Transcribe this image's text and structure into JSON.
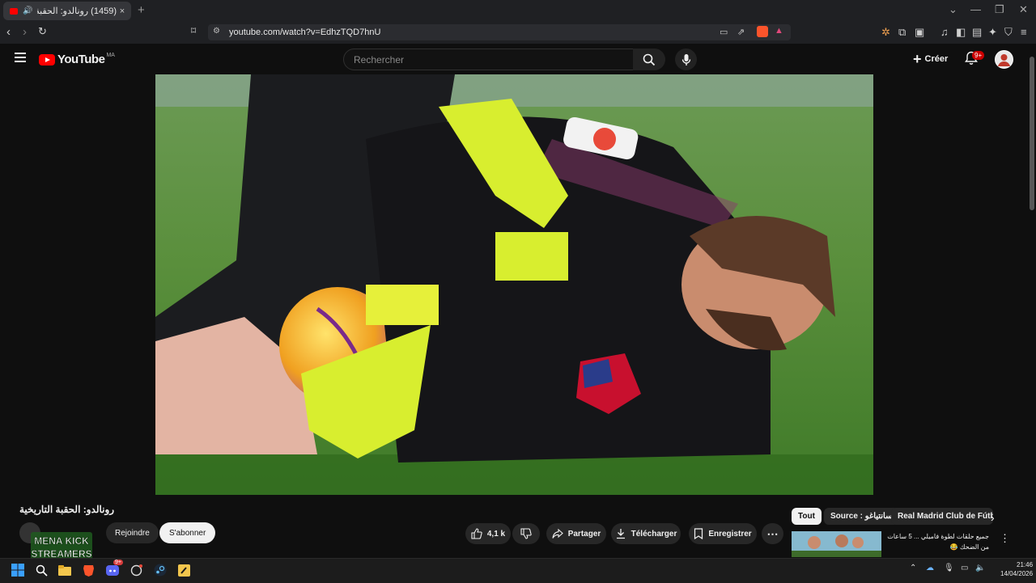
{
  "browser": {
    "tab_title": "(1459) رونالدو: الحقبة التاريخية",
    "url": "youtube.com/watch?v=EdhzTQD7hnU",
    "new_tab": "+",
    "tab_close": "×"
  },
  "youtube": {
    "logo_text": "YouTube",
    "country_code": "MA",
    "search_placeholder": "Rechercher",
    "create_label": "Créer",
    "notifications_badge": "9+"
  },
  "video": {
    "title": "رونالدو: الحقبة التاريخية",
    "join_label": "Rejoindre",
    "subscribe_label": "S'abonner",
    "like_count": "4,1 k",
    "share_label": "Partager",
    "download_label": "Télécharger",
    "save_label": "Enregistrer",
    "more": "⋯"
  },
  "watermark": {
    "line1": "MENA KICK",
    "line2": "STREAMERS"
  },
  "sidebar": {
    "chips": [
      "Tout",
      "Source : سانتياغو",
      "Real Madrid Club de Fútbol"
    ],
    "rec_title": "جميع حلقات لطوة فاميلي ... 5 ساعات من الضحك 😂"
  },
  "taskbar": {
    "time": "21:46",
    "date": "14/04/2026",
    "discord_badge": "9+"
  },
  "colors": {
    "accent_red": "#ff0000",
    "background": "#0f0f0f",
    "pill": "#272727"
  }
}
